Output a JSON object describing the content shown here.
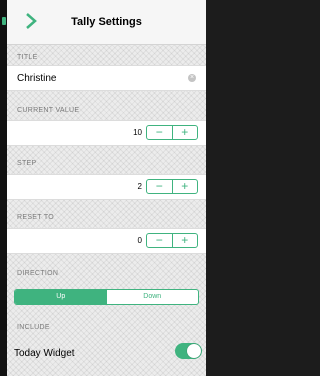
{
  "navbar": {
    "title": "Tally Settings",
    "back_icon": "chevron-right-icon"
  },
  "title_section": {
    "label": "TITLE",
    "value": "Christine"
  },
  "current_value_section": {
    "label": "CURRENT VALUE",
    "value": "10"
  },
  "step_section": {
    "label": "STEP",
    "value": "2"
  },
  "reset_section": {
    "label": "RESET TO",
    "value": "0"
  },
  "stepper": {
    "minus": "−",
    "plus": "+"
  },
  "direction_section": {
    "label": "DIRECTION",
    "options": [
      "Up",
      "Down"
    ],
    "selected": "Up"
  },
  "include_section": {
    "label": "INCLUDE",
    "widget_label": "Today Widget",
    "widget_enabled": true
  },
  "colors": {
    "accent": "#3fb37f"
  }
}
